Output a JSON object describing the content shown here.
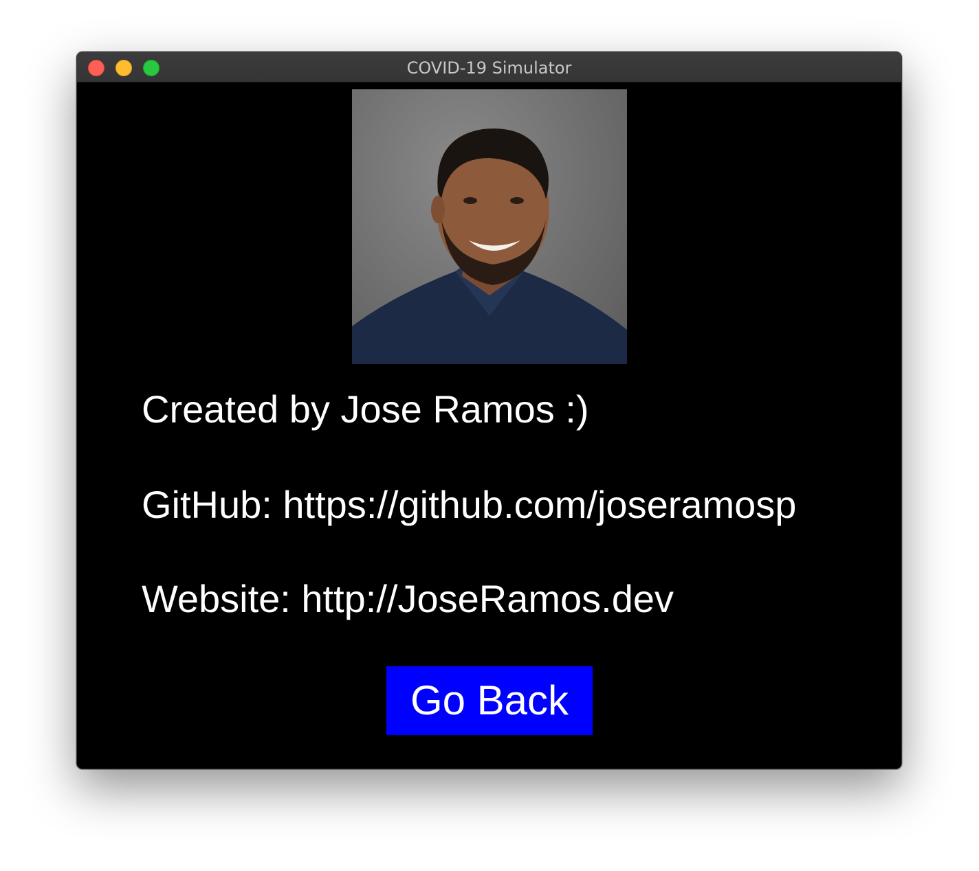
{
  "window": {
    "title": "COVID-19 Simulator",
    "controls": [
      "close",
      "minimize",
      "zoom"
    ]
  },
  "profile": {
    "photo_icon": "portrait-photo",
    "created_by": "Created by Jose Ramos :)",
    "github": "GitHub: https://github.com/joseramosp",
    "website": "Website: http://JoseRamos.dev"
  },
  "actions": {
    "go_back_label": "Go Back"
  },
  "colors": {
    "background": "#000000",
    "text": "#ffffff",
    "button": "#0000ff",
    "close": "#fe5f57",
    "minimize": "#febc2e",
    "zoom": "#28c840"
  }
}
